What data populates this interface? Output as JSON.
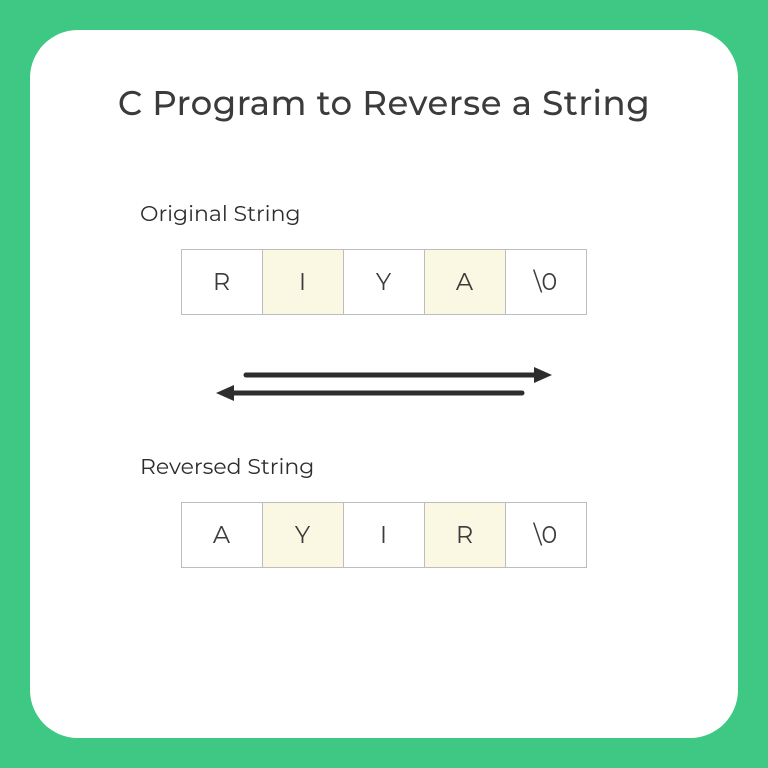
{
  "title": "C Program to Reverse a String",
  "original": {
    "label": "Original String",
    "cells": [
      "R",
      "I",
      "Y",
      "A",
      "\\0"
    ],
    "highlight": [
      false,
      true,
      false,
      true,
      false
    ]
  },
  "reversed": {
    "label": "Reversed String",
    "cells": [
      "A",
      "Y",
      "I",
      "R",
      "\\0"
    ],
    "highlight": [
      false,
      true,
      false,
      true,
      false
    ]
  }
}
